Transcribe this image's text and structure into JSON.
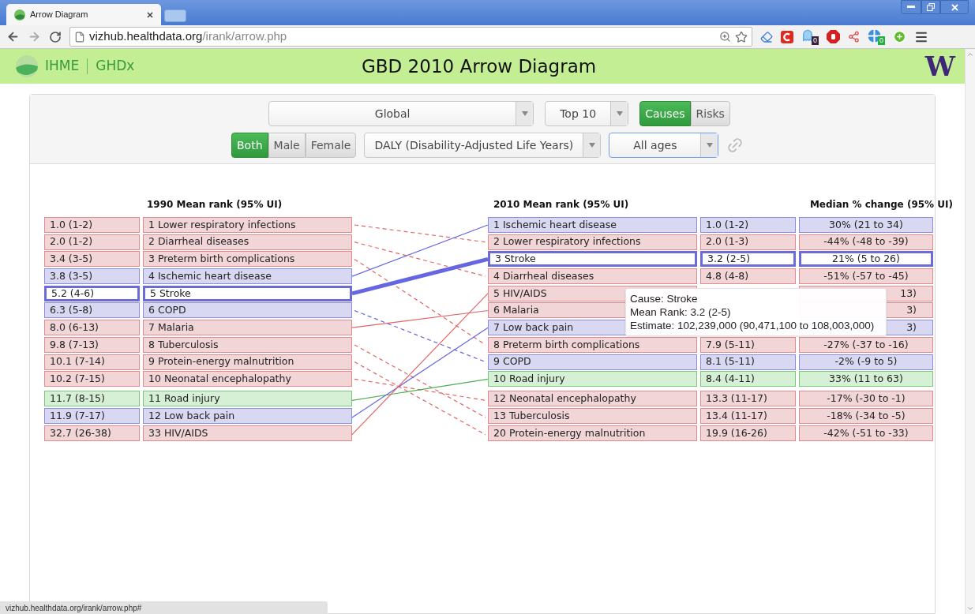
{
  "browser": {
    "tab_title": "Arrow Diagram",
    "url_host": "vizhub.healthdata.org",
    "url_path": "/irank/arrow.php",
    "extension_badges": [
      "0",
      "0"
    ],
    "status_url": "vizhub.healthdata.org/irank/arrow.php#"
  },
  "header": {
    "brand": "IHME",
    "sub_brand": "GHDx",
    "title": "GBD 2010 Arrow Diagram",
    "logo_letter": "W"
  },
  "controls": {
    "location": "Global",
    "top": "Top 10",
    "mode_toggle": [
      {
        "label": "Causes",
        "selected": true
      },
      {
        "label": "Risks",
        "selected": false
      }
    ],
    "sex_toggle": [
      {
        "label": "Both",
        "selected": true
      },
      {
        "label": "Male",
        "selected": false
      },
      {
        "label": "Female",
        "selected": false
      }
    ],
    "metric": "DALY (Disability-Adjusted Life Years)",
    "age": "All ages"
  },
  "diagram": {
    "left_header": "1990 Mean rank (95% UI)",
    "right_header": "2010 Mean rank (95% UI)",
    "change_header": "Median % change (95% UI)",
    "left_groups": [
      {
        "rows": [
          {
            "rank": "1.0 (1-2)",
            "name": "1 Lower respiratory infections",
            "color": "#e06666",
            "selected": false
          },
          {
            "rank": "2.0 (1-2)",
            "name": "2 Diarrheal diseases",
            "color": "#e06666",
            "selected": false
          },
          {
            "rank": "3.4 (3-5)",
            "name": "3 Preterm birth complications",
            "color": "#e06666",
            "selected": false
          },
          {
            "rank": "3.8 (3-5)",
            "name": "4 Ischemic heart disease",
            "color": "#6666e0",
            "selected": false
          },
          {
            "rank": "5.2 (4-6)",
            "name": "5 Stroke",
            "color": "#6666e0",
            "selected": true
          },
          {
            "rank": "6.3 (5-8)",
            "name": "6 COPD",
            "color": "#6666e0",
            "selected": false
          },
          {
            "rank": "8.0 (6-13)",
            "name": "7 Malaria",
            "color": "#e06666",
            "selected": false
          },
          {
            "rank": "9.8 (7-13)",
            "name": "8 Tuberculosis",
            "color": "#e06666",
            "selected": false
          },
          {
            "rank": "10.1 (7-14)",
            "name": "9 Protein-energy malnutrition",
            "color": "#e06666",
            "selected": false
          },
          {
            "rank": "10.2 (7-15)",
            "name": "10 Neonatal encephalopathy",
            "color": "#e06666",
            "selected": false
          }
        ]
      },
      {
        "rows": [
          {
            "rank": "11.7 (8-15)",
            "name": "11 Road injury",
            "color": "#4caf50",
            "selected": false
          },
          {
            "rank": "11.9 (7-17)",
            "name": "12 Low back pain",
            "color": "#6666e0",
            "selected": false
          },
          {
            "rank": "32.7 (26-38)",
            "name": "33 HIV/AIDS",
            "color": "#e06666",
            "selected": false
          }
        ]
      }
    ],
    "right_groups": [
      {
        "rows": [
          {
            "name": "1 Ischemic heart disease",
            "rank": "1.0 (1-2)",
            "change": "30% (21 to 34)",
            "selected": false
          },
          {
            "name": "2 Lower respiratory infections",
            "rank": "2.0 (1-3)",
            "change": "-44% (-48 to -39)",
            "selected": false
          },
          {
            "name": "3 Stroke",
            "rank": "3.2 (2-5)",
            "change": "21% (5 to 26)",
            "selected": true
          },
          {
            "name": "4 Diarrheal diseases",
            "rank": "4.8 (4-8)",
            "change": "-51% (-57 to -45)",
            "selected": false
          },
          {
            "name": "5 HIV/AIDS",
            "change": "13)",
            "selected": false
          },
          {
            "name": "6 Malaria",
            "change": "3)",
            "selected": false
          },
          {
            "name": "7 Low back pain",
            "change": "3)",
            "selected": false
          },
          {
            "name": "8 Preterm birth complications",
            "rank": "7.9 (5-11)",
            "change": "-27% (-37 to -16)",
            "selected": false
          },
          {
            "name": "9 COPD",
            "rank": "8.1 (5-11)",
            "change": "-2% (-9 to 5)",
            "selected": false
          },
          {
            "name": "10 Road injury",
            "rank": "8.4 (4-11)",
            "change": "33% (11 to 63)",
            "selected": false
          }
        ]
      },
      {
        "rows": [
          {
            "name": "12 Neonatal encephalopathy",
            "rank": "13.3 (11-17)",
            "change": "-17% (-30 to -1)",
            "selected": false
          },
          {
            "name": "13 Tuberculosis",
            "rank": "13.4 (11-17)",
            "change": "-18% (-34 to -5)",
            "selected": false
          },
          {
            "name": "20 Protein-energy malnutrition",
            "rank": "19.9 (16-26)",
            "change": "-42% (-51 to -33)",
            "selected": false
          }
        ]
      }
    ],
    "tooltip": {
      "lines": [
        "Cause: Stroke",
        "Mean Rank: 3.2 (2-5)",
        "Estimate: 102,239,000 (90,471,100 to 108,003,000)"
      ]
    }
  }
}
